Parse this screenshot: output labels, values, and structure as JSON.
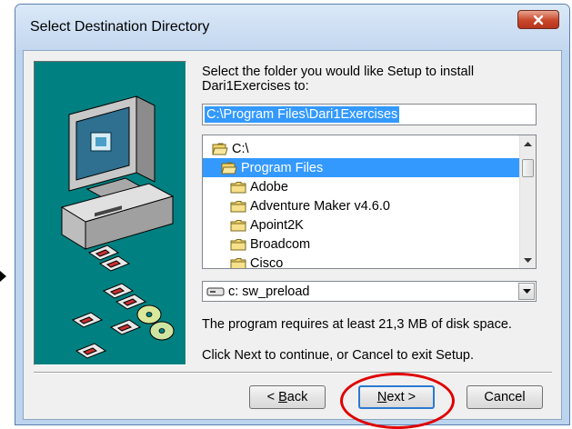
{
  "window": {
    "title": "Select Destination Directory",
    "close_label": "x"
  },
  "dialog": {
    "prompt": "Select the folder you would like Setup to install Dari1Exercises to:",
    "path_value": "C:\\Program Files\\Dari1Exercises",
    "folders": [
      {
        "name": "C:\\",
        "icon": "open-folder-icon",
        "indent": 0,
        "selected": false
      },
      {
        "name": "Program Files",
        "icon": "open-folder-icon",
        "indent": 1,
        "selected": true
      },
      {
        "name": "Adobe",
        "icon": "folder-icon",
        "indent": 2,
        "selected": false
      },
      {
        "name": "Adventure Maker v4.6.0",
        "icon": "folder-icon",
        "indent": 2,
        "selected": false
      },
      {
        "name": "Apoint2K",
        "icon": "folder-icon",
        "indent": 2,
        "selected": false
      },
      {
        "name": "Broadcom",
        "icon": "folder-icon",
        "indent": 2,
        "selected": false
      },
      {
        "name": "Cisco",
        "icon": "folder-icon",
        "indent": 2,
        "selected": false
      }
    ],
    "drive": "c: sw_preload",
    "disk_space": "The program requires at least 21,3 MB of disk space.",
    "instruction": "Click Next to continue, or Cancel to exit Setup."
  },
  "buttons": {
    "back": {
      "prefix": "< ",
      "mnemonic": "B",
      "rest": "ack"
    },
    "next": {
      "mnemonic": "N",
      "rest": "ext >"
    },
    "cancel": "Cancel"
  },
  "colors": {
    "accent": "#3399ff",
    "panel": "#008080",
    "highlight_circle": "#e00000"
  }
}
